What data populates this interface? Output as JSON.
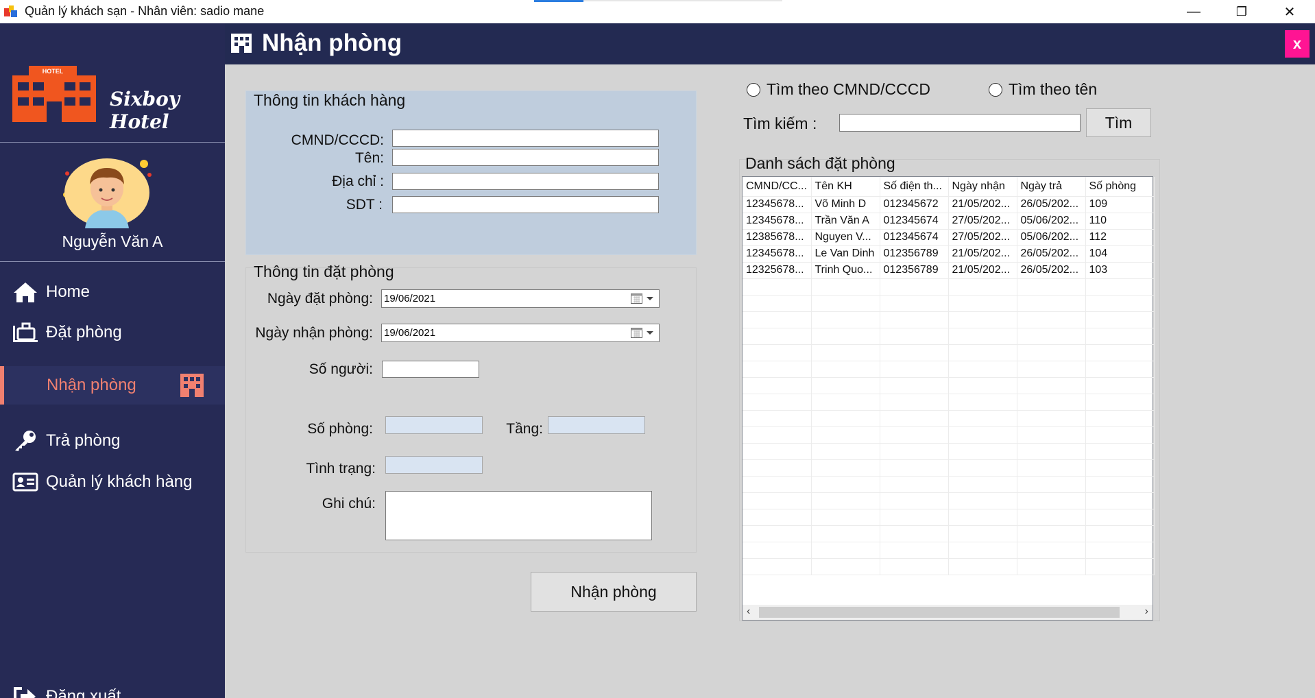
{
  "window": {
    "title": "Quản lý khách sạn - Nhân viên: sadio mane",
    "minimize": "—",
    "maximize": "❐",
    "close": "✕"
  },
  "header": {
    "title": "Nhận phòng",
    "close_label": "x"
  },
  "sidebar": {
    "logo_text": "HOTEL",
    "brand": "Sixboy Hotel",
    "user_name": "Nguyễn Văn A",
    "items": [
      {
        "label": "Home",
        "icon": "home-icon"
      },
      {
        "label": "Đặt phòng",
        "icon": "luggage-icon"
      },
      {
        "label": "Nhận phòng",
        "icon": "building-icon",
        "active": true
      },
      {
        "label": "Trả phòng",
        "icon": "key-icon"
      },
      {
        "label": "Quản lý khách hàng",
        "icon": "id-card-icon"
      }
    ],
    "logout": "Đăng xuất"
  },
  "customer": {
    "title": "Thông tin khách hàng",
    "id_label": "CMND/CCCD:",
    "name_label": "Tên:",
    "address_label": "Địa chỉ :",
    "phone_label": "SDT :"
  },
  "booking": {
    "title": "Thông tin đặt phòng",
    "booking_date_label": "Ngày đặt phòng:",
    "booking_date": "19/06/2021",
    "checkin_date_label": "Ngày nhận phòng:",
    "checkin_date": "19/06/2021",
    "people_label": "Số người:",
    "room_label": "Số phòng:",
    "floor_label": "Tầng:",
    "status_label": "Tình trạng:",
    "note_label": "Ghi chú:"
  },
  "checkin_button": "Nhận phòng",
  "search": {
    "by_id": "Tìm theo CMND/CCCD",
    "by_name": "Tìm theo tên",
    "label": "Tìm kiếm :",
    "button": "Tìm"
  },
  "reservations": {
    "title": "Danh sách đặt phòng",
    "columns": [
      "CMND/CC...",
      "Tên KH",
      "Số điện th...",
      "Ngày nhận",
      "Ngày trả",
      "Số phòng"
    ],
    "rows": [
      [
        "12345678...",
        "Võ Minh D",
        "012345672",
        "21/05/202...",
        "26/05/202...",
        "109"
      ],
      [
        "12345678...",
        "Trần Văn A",
        "012345674",
        "27/05/202...",
        "05/06/202...",
        "110"
      ],
      [
        "12385678...",
        "Nguyen V...",
        "012345674",
        "27/05/202...",
        "05/06/202...",
        "112"
      ],
      [
        "12345678...",
        "Le Van Dinh",
        "012356789",
        "21/05/202...",
        "26/05/202...",
        "104"
      ],
      [
        "12325678...",
        "Trinh Quo...",
        "012356789",
        "21/05/202...",
        "26/05/202...",
        "103"
      ]
    ]
  }
}
